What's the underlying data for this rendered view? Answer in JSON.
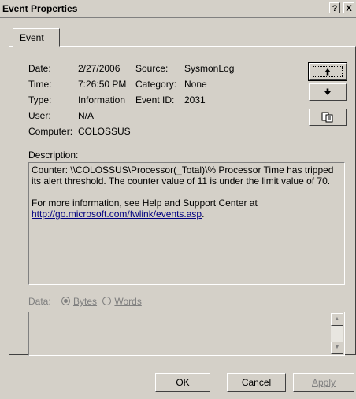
{
  "window": {
    "title": "Event Properties",
    "help_glyph": "?",
    "close_glyph": "X"
  },
  "tab": {
    "label": "Event"
  },
  "fields": {
    "date_label": "Date:",
    "date_value": "2/27/2006",
    "time_label": "Time:",
    "time_value": "7:26:50 PM",
    "type_label": "Type:",
    "type_value": "Information",
    "user_label": "User:",
    "user_value": "N/A",
    "computer_label": "Computer:",
    "computer_value": "COLOSSUS",
    "source_label": "Source:",
    "source_value": "SysmonLog",
    "category_label": "Category:",
    "category_value": "None",
    "event_id_label": "Event ID:",
    "event_id_value": "2031"
  },
  "description": {
    "label": "Description:",
    "line1": "Counter: \\\\COLOSSUS\\Processor(_Total)\\% Processor Time has tripped its alert threshold. The counter value of 11 is under the limit value of 70.",
    "line2": "For more information, see Help and Support Center at",
    "link": "http://go.microsoft.com/fwlink/events.asp",
    "link_suffix": "."
  },
  "data": {
    "label": "Data:",
    "bytes_label": "Bytes",
    "words_label": "Words",
    "selected": "Bytes"
  },
  "side_buttons": {
    "up_icon": "arrow-up-icon",
    "down_icon": "arrow-down-icon",
    "copy_icon": "copy-icon"
  },
  "buttons": {
    "ok": "OK",
    "cancel": "Cancel",
    "apply": "Apply"
  },
  "colors": {
    "face": "#d4d0c8",
    "link": "#000080",
    "disabled": "#808080"
  }
}
